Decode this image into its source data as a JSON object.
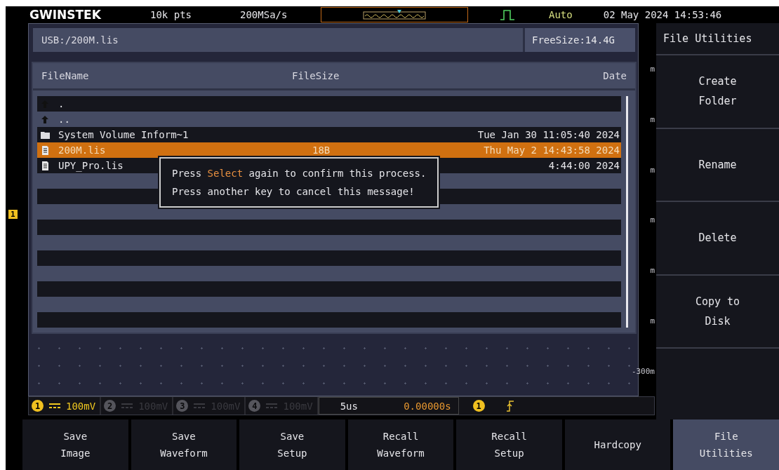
{
  "top_bar": {
    "logo": "GWINSTEK",
    "record_length": "10k pts",
    "sample_rate": "200MSa/s",
    "trigger_mode": "Auto",
    "datetime": "02 May 2024 14:53:46"
  },
  "path_bar": {
    "path": "USB:/200M.lis",
    "free_size": "FreeSize:14.4G"
  },
  "file_table": {
    "columns": [
      "FileName",
      "FileSize",
      "Date"
    ],
    "rows": [
      {
        "kind": "up",
        "name": ".",
        "selected": false
      },
      {
        "kind": "up",
        "name": "..",
        "selected": false
      },
      {
        "kind": "folder",
        "name": "System Volume Inform~1",
        "date": "Tue Jan 30 11:05:40 2024",
        "selected": false
      },
      {
        "kind": "file",
        "name": "200M.lis",
        "size": "18B",
        "date": "Thu May  2 14:43:58 2024",
        "selected": true
      },
      {
        "kind": "file",
        "name": "UPY_Pro.lis",
        "date": "4:44:00 2024",
        "selected": false
      }
    ]
  },
  "dialog": {
    "lines": [
      {
        "before": "Press ",
        "highlight": "Select",
        "after": " again to confirm this process."
      },
      {
        "before": "Press another key to cancel this message!"
      }
    ]
  },
  "scale_labels": [
    "m",
    "m",
    "m",
    "m",
    "m",
    "m",
    "-300m"
  ],
  "channel_marker": "1",
  "channels": [
    {
      "number": "1",
      "scale": "100mV",
      "on": true
    },
    {
      "number": "2",
      "scale": "100mV",
      "on": false
    },
    {
      "number": "3",
      "scale": "100mV",
      "on": false
    },
    {
      "number": "4",
      "scale": "100mV",
      "on": false
    }
  ],
  "timebase": {
    "scale": "5us",
    "position": "0.00000s"
  },
  "trigger": {
    "source": "1"
  },
  "side_menu": {
    "title": "File Utilities",
    "items": [
      [
        "Create",
        "Folder"
      ],
      [
        "Rename"
      ],
      [
        "Delete"
      ],
      [
        "Copy to",
        "Disk"
      ]
    ]
  },
  "soft_keys": [
    {
      "lines": [
        "Save",
        "Image"
      ],
      "selected": false
    },
    {
      "lines": [
        "Save",
        "Waveform"
      ],
      "selected": false
    },
    {
      "lines": [
        "Save",
        "Setup"
      ],
      "selected": false
    },
    {
      "lines": [
        "Recall",
        "Waveform"
      ],
      "selected": false
    },
    {
      "lines": [
        "Recall",
        "Setup"
      ],
      "selected": false
    },
    {
      "lines": [
        "Hardcopy"
      ],
      "selected": false
    },
    {
      "lines": [
        "File",
        "Utilities"
      ],
      "selected": true
    }
  ]
}
